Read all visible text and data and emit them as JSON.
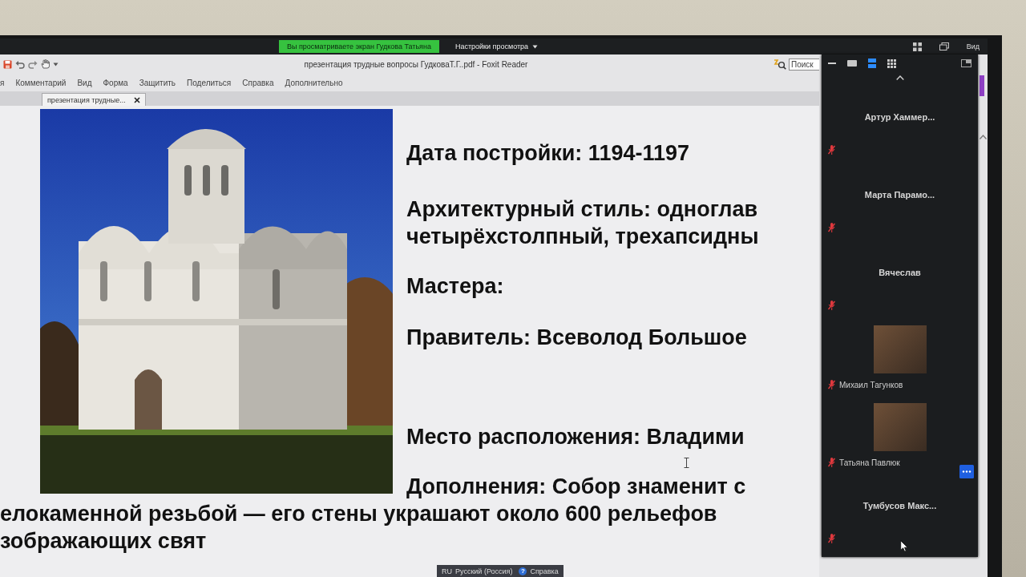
{
  "share_bar": {
    "notice": "Вы просматриваете экран Гудкова Татьяна",
    "settings": "Настройки просмотра",
    "view": "Вид"
  },
  "window": {
    "title": "презентация трудные вопросы ГудковаТ.Г..pdf - Foxit Reader",
    "search": {
      "placeholder": "Поиск"
    }
  },
  "menu": [
    "я",
    "Комментарий",
    "Вид",
    "Форма",
    "Защитить",
    "Поделиться",
    "Справка",
    "Дополнительно"
  ],
  "tabs": [
    {
      "label": "презентация трудные...",
      "selected": true
    }
  ],
  "document": {
    "lines": [
      "Дата постройки: 1194-1197",
      "Архитектурный стиль: одноглав",
      "четырёхстолпный, трехапсидны",
      "Мастера:",
      "Правитель: Всеволод Большое",
      "Место расположения: Владими",
      "Дополнения: Собор знаменит с"
    ],
    "continuation": [
      "елокаменной резьбой — его стены украшают около 600 рельефов",
      "зображающих свят"
    ]
  },
  "participants_panel": {
    "view_modes": [
      {
        "kind": "speaker",
        "selected": false
      },
      {
        "kind": "strip",
        "selected": true
      },
      {
        "kind": "gallery",
        "selected": false
      }
    ],
    "participants": [
      {
        "kind": "name",
        "name": "Артур Хаммер...",
        "muted": true,
        "hovered": false
      },
      {
        "kind": "name",
        "name": "Марта Парамо...",
        "muted": true,
        "hovered": false
      },
      {
        "kind": "name",
        "name": "Вячеслав",
        "muted": true,
        "hovered": false
      },
      {
        "kind": "video",
        "name": "Михаил Тагунков",
        "muted": true,
        "hovered": false
      },
      {
        "kind": "video",
        "name": "Татьяна Павлюк",
        "muted": true,
        "hovered": true
      },
      {
        "kind": "name",
        "name": "Тумбусов Макс...",
        "muted": true,
        "hovered": false
      }
    ]
  },
  "language_bar": {
    "code": "RU",
    "language": "Русский (Россия)",
    "help_icon": "?",
    "help": "Справка"
  }
}
